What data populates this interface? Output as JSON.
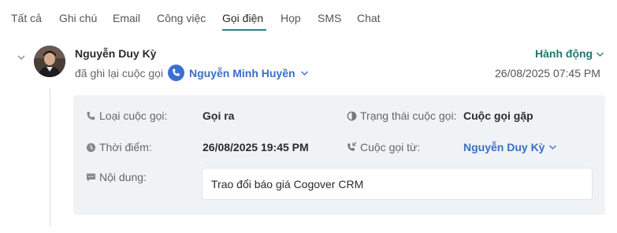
{
  "tabs": [
    {
      "label": "Tất cả"
    },
    {
      "label": "Ghi chú"
    },
    {
      "label": "Email"
    },
    {
      "label": "Công việc"
    },
    {
      "label": "Gọi điện"
    },
    {
      "label": "Họp"
    },
    {
      "label": "SMS"
    },
    {
      "label": "Chat"
    }
  ],
  "active_tab": "Gọi điện",
  "activity": {
    "author": "Nguyễn Duy Kỳ",
    "action_text": "đã ghi lại cuộc gọi",
    "contact": "Nguyễn Minh Huyền",
    "actions_label": "Hành động",
    "timestamp": "26/08/2025 07:45 PM"
  },
  "details": {
    "call_type_label": "Loại cuộc gọi:",
    "call_type_value": "Gọi ra",
    "call_status_label": "Trạng thái cuộc gọi:",
    "call_status_value": "Cuộc gọi gặp",
    "time_label": "Thời điểm:",
    "time_value": "26/08/2025 19:45 PM",
    "call_from_label": "Cuộc gọi từ:",
    "call_from_value": "Nguyễn Duy Kỳ",
    "content_label": "Nội dung:",
    "content_value": "Trao đổi báo giá Cogover CRM"
  },
  "icons": {
    "collapse": "chevron-down-icon",
    "avatar": "avatar",
    "phone_badge": "phone-icon",
    "call_type": "phone-icon",
    "call_status": "half-circle-icon",
    "time": "clock-icon",
    "call_from": "phone-incoming-icon",
    "content": "comment-icon"
  },
  "colors": {
    "accent": "#22878a",
    "link": "#3a6ec9",
    "action": "#1f7a6e",
    "panel_bg": "#f0f3f5"
  }
}
